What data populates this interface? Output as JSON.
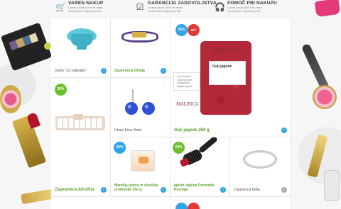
{
  "benefits": [
    {
      "icon": "cart-icon",
      "title": "VAREN NAKUP",
      "desc": "Lorem ipsum dolor sit amet, consectetur adipiscing elit."
    },
    {
      "icon": "checkbox-icon",
      "title": "GARANCIJA ZADOVOLJSTVA",
      "desc": "Lorem ipsum dolor sit amet, consectetur adipiscing elit."
    },
    {
      "icon": "headset-icon",
      "title": "POMOČ PRI NAKUPU",
      "desc": "Lorem ipsum dolor sit amet, consectetur adipiscing elit."
    }
  ],
  "products": {
    "bowl": {
      "name": "Darilo \"Za najboljše\""
    },
    "purple_bracelet": {
      "name": "Zapestnica Ofelija"
    },
    "goji": {
      "name": "Goji jagode 250 g",
      "label": "Goji jagode",
      "brand": "MALINCA",
      "badge_discount": "25%",
      "badge_hit": "HIT",
      "tip": "Lorem ipsum dolor sit amet, consectetur adipiscing elit."
    },
    "earrings": {
      "name": "Uhani Ema Violet"
    },
    "gold_bracelet": {
      "name": "Zapestnica Afrodita",
      "badge": "30%"
    },
    "mandelj": {
      "name": "Mandlja jedrca in okoliške probiotike 250 g",
      "badge": "25%"
    },
    "roller": {
      "name": "Igliční valjček Dermafile Prestige",
      "badge": "24%"
    },
    "bella": {
      "name": "Zapestnica Bella"
    }
  }
}
